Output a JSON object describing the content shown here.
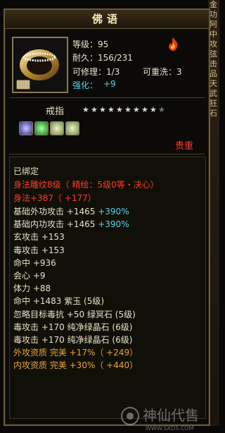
{
  "title": "佛语",
  "item": {
    "level": "等级：95",
    "durability": "耐久：156/231",
    "repairable": "可修理：1/3",
    "rewashable": "可重洗：3",
    "enhance_label": "强化：",
    "enhance_value": "+9",
    "type": "戒指",
    "stars_filled": 9,
    "stars_total": 10,
    "rarity": "贵重"
  },
  "side_text": [
    "金",
    "功",
    "阿",
    "中",
    "攻",
    "弦",
    "击",
    "品",
    "天",
    "武",
    "狂",
    "石"
  ],
  "bound": "已绑定",
  "engrave": "身法雕纹8级（ 精绘：5级0等・决心）",
  "engrave_bonus": "身法+387（ +177）",
  "lines": [
    {
      "parts": [
        {
          "t": "基础外功攻击 +1465 ",
          "c": "gold"
        },
        {
          "t": "+390%",
          "c": "cyan"
        }
      ]
    },
    {
      "parts": [
        {
          "t": "基础内功攻击 +1465 ",
          "c": "gold"
        },
        {
          "t": "+390%",
          "c": "cyan"
        }
      ]
    },
    {
      "parts": [
        {
          "t": "玄攻击 +153",
          "c": "gold"
        }
      ]
    },
    {
      "parts": [
        {
          "t": "毒攻击 +153",
          "c": "gold"
        }
      ]
    },
    {
      "parts": [
        {
          "t": "命中 +936",
          "c": "gold"
        }
      ]
    },
    {
      "parts": [
        {
          "t": "会心 +9",
          "c": "gold"
        }
      ]
    },
    {
      "parts": [
        {
          "t": "体力 +88",
          "c": "gold"
        }
      ]
    },
    {
      "parts": [
        {
          "t": "命中 +1483 紫玉 (5级)",
          "c": "gold"
        }
      ]
    },
    {
      "parts": [
        {
          "t": "忽略目标毒抗 +50 绿冥石 (5级)",
          "c": "gold"
        }
      ]
    },
    {
      "parts": [
        {
          "t": "毒攻击 +170 纯净绿晶石 (6级)",
          "c": "gold"
        }
      ]
    },
    {
      "parts": [
        {
          "t": "毒攻击 +170 纯净绿晶石 (6级)",
          "c": "gold"
        }
      ]
    },
    {
      "parts": [
        {
          "t": "外攻资质  完美 +17%（ +249）",
          "c": "orange"
        }
      ]
    },
    {
      "parts": [
        {
          "t": "内攻资质  完美 +30%（ +440）",
          "c": "orange"
        }
      ]
    }
  ],
  "watermark": "神仙代售",
  "watermark_url": "WWW.SXDS.COM"
}
